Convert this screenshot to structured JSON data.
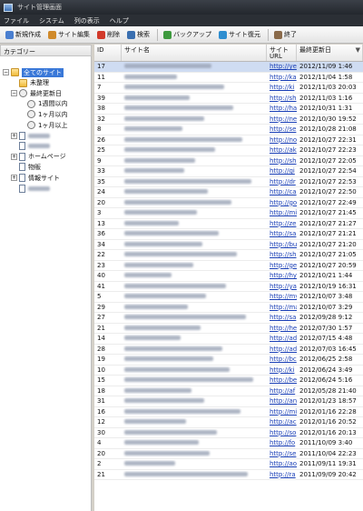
{
  "window": {
    "title": "サイト管理画面"
  },
  "menu": [
    "ファイル",
    "システム",
    "列の表示",
    "ヘルプ"
  ],
  "toolbar": {
    "buttons": [
      {
        "label": "新規作成",
        "icon": "new-document-icon",
        "color": "#4a7fd0"
      },
      {
        "label": "サイト編集",
        "icon": "pencil-icon",
        "color": "#d08a2a"
      },
      {
        "label": "削除",
        "icon": "delete-icon",
        "color": "#d23a2a"
      },
      {
        "label": "検索",
        "icon": "magnifier-icon",
        "color": "#3a6fb0"
      },
      {
        "label": "バックアップ",
        "icon": "backup-icon",
        "color": "#3e9a3e"
      },
      {
        "label": "サイト復元",
        "icon": "restore-icon",
        "color": "#2e8ed0"
      },
      {
        "label": "終了",
        "icon": "exit-icon",
        "color": "#8a6a4a"
      }
    ]
  },
  "sidebar": {
    "title": "カテゴリー",
    "tree": [
      {
        "label": "全てのサイト",
        "icon": "folder-icon",
        "level": 0,
        "expander": "−",
        "selected": true,
        "blur": false
      },
      {
        "label": "未整理",
        "icon": "folder-icon",
        "level": 1,
        "expander": "",
        "selected": false,
        "blur": false
      },
      {
        "label": "最終更新日",
        "icon": "clock-icon",
        "level": 1,
        "expander": "−",
        "selected": false,
        "blur": false
      },
      {
        "label": "1週間以内",
        "icon": "clock-icon",
        "level": 2,
        "expander": "",
        "selected": false,
        "blur": false
      },
      {
        "label": "1ヶ月以内",
        "icon": "clock-icon",
        "level": 2,
        "expander": "",
        "selected": false,
        "blur": false
      },
      {
        "label": "1ヶ月以上",
        "icon": "clock-icon",
        "level": 2,
        "expander": "",
        "selected": false,
        "blur": false
      },
      {
        "label": "",
        "icon": "doc-icon",
        "level": 1,
        "expander": "+",
        "selected": false,
        "blur": true
      },
      {
        "label": "",
        "icon": "doc-icon",
        "level": 1,
        "expander": "",
        "selected": false,
        "blur": true
      },
      {
        "label": "ホームページ",
        "icon": "doc-icon",
        "level": 1,
        "expander": "+",
        "selected": false,
        "blur": false
      },
      {
        "label": "物販",
        "icon": "doc-icon",
        "level": 1,
        "expander": "",
        "selected": false,
        "blur": false
      },
      {
        "label": "情報サイト",
        "icon": "doc-icon",
        "level": 1,
        "expander": "+",
        "selected": false,
        "blur": false
      },
      {
        "label": "",
        "icon": "doc-icon",
        "level": 1,
        "expander": "",
        "selected": false,
        "blur": true
      }
    ]
  },
  "grid": {
    "columns": {
      "id": "ID",
      "name": "サイト名",
      "url": "サイト URL",
      "date": "最終更新日"
    },
    "sort_indicator": "▼",
    "rows": [
      {
        "id": "17",
        "url": "http://ye",
        "date": "2012/11/09 1:46"
      },
      {
        "id": "11",
        "url": "http://ka",
        "date": "2012/11/04 1:58"
      },
      {
        "id": "7",
        "url": "http://ki",
        "date": "2012/11/03 20:03"
      },
      {
        "id": "39",
        "url": "http://sh",
        "date": "2012/11/03 1:16"
      },
      {
        "id": "38",
        "url": "http://ha",
        "date": "2012/10/31 1:31"
      },
      {
        "id": "32",
        "url": "http://ne",
        "date": "2012/10/30 19:52"
      },
      {
        "id": "8",
        "url": "http://se",
        "date": "2012/10/28 21:08"
      },
      {
        "id": "26",
        "url": "http://no",
        "date": "2012/10/27 22:31"
      },
      {
        "id": "25",
        "url": "http://ak",
        "date": "2012/10/27 22:23"
      },
      {
        "id": "9",
        "url": "http://sh",
        "date": "2012/10/27 22:05"
      },
      {
        "id": "33",
        "url": "http://gi",
        "date": "2012/10/27 22:54"
      },
      {
        "id": "35",
        "url": "http://dr",
        "date": "2012/10/27 22:53"
      },
      {
        "id": "24",
        "url": "http://ca",
        "date": "2012/10/27 22:50"
      },
      {
        "id": "20",
        "url": "http://go",
        "date": "2012/10/27 22:49"
      },
      {
        "id": "3",
        "url": "http://mi",
        "date": "2012/10/27 21:45"
      },
      {
        "id": "13",
        "url": "http://ze",
        "date": "2012/10/27 21:27"
      },
      {
        "id": "36",
        "url": "http://sa",
        "date": "2012/10/27 21:21"
      },
      {
        "id": "34",
        "url": "http://bu",
        "date": "2012/10/27 21:20"
      },
      {
        "id": "22",
        "url": "http://sh",
        "date": "2012/10/27 21:05"
      },
      {
        "id": "23",
        "url": "http://ge",
        "date": "2012/10/27 20:59"
      },
      {
        "id": "40",
        "url": "http://hy",
        "date": "2012/10/21 1:44"
      },
      {
        "id": "41",
        "url": "http://ya",
        "date": "2012/10/19 16:31"
      },
      {
        "id": "5",
        "url": "http://my",
        "date": "2012/10/07 3:48"
      },
      {
        "id": "29",
        "url": "http://ma",
        "date": "2012/10/07 3:29"
      },
      {
        "id": "27",
        "url": "http://sa",
        "date": "2012/09/28 9:12"
      },
      {
        "id": "21",
        "url": "http://he",
        "date": "2012/07/30 1:57"
      },
      {
        "id": "14",
        "url": "http://ad",
        "date": "2012/07/15 4:48"
      },
      {
        "id": "28",
        "url": "http://ad",
        "date": "2012/07/03 16:45"
      },
      {
        "id": "19",
        "url": "http://bc",
        "date": "2012/06/25 2:58"
      },
      {
        "id": "10",
        "url": "http://ki",
        "date": "2012/06/24 3:49"
      },
      {
        "id": "15",
        "url": "http://be",
        "date": "2012/06/24 5:16"
      },
      {
        "id": "18",
        "url": "http://af",
        "date": "2012/05/28 21:40"
      },
      {
        "id": "31",
        "url": "http://an",
        "date": "2012/01/23 18:57"
      },
      {
        "id": "16",
        "url": "http://mi",
        "date": "2012/01/16 22:28"
      },
      {
        "id": "12",
        "url": "http://ac",
        "date": "2012/01/16 20:52"
      },
      {
        "id": "30",
        "url": "http://so",
        "date": "2012/01/16 20:13"
      },
      {
        "id": "4",
        "url": "http://fo",
        "date": "2011/10/09 3:40"
      },
      {
        "id": "20",
        "url": "http://se",
        "date": "2011/10/04 22:23"
      },
      {
        "id": "2",
        "url": "http://ao",
        "date": "2011/09/11 19:31"
      },
      {
        "id": "21",
        "url": "http://ra",
        "date": "2011/09/09 20:42"
      }
    ]
  }
}
